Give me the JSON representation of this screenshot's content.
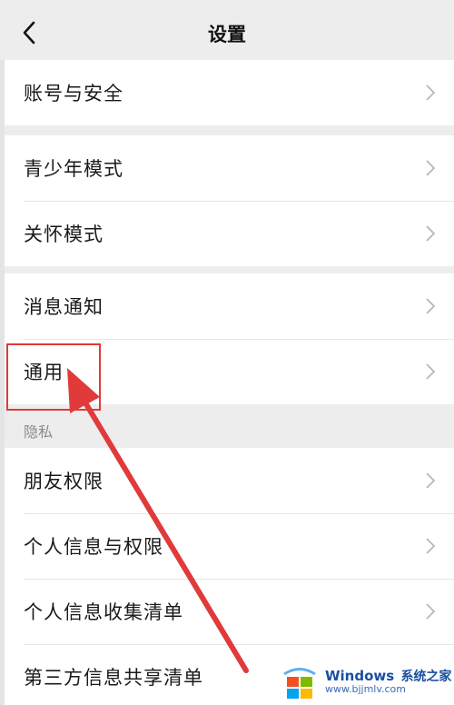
{
  "nav": {
    "title": "设置"
  },
  "groups": [
    {
      "items": [
        "账号与安全"
      ]
    },
    {
      "items": [
        "青少年模式",
        "关怀模式"
      ]
    },
    {
      "items": [
        "消息通知",
        "通用"
      ]
    }
  ],
  "privacy_section": {
    "header": "隐私",
    "items": [
      "朋友权限",
      "个人信息与权限",
      "个人信息收集清单",
      "第三方信息共享清单"
    ]
  },
  "watermark": {
    "brand": "Windows",
    "brand_cn": "系统之家",
    "url": "www.bjjmlv.com"
  },
  "colors": {
    "highlight": "#e03a3a",
    "chevron": "#b8b8b8"
  }
}
